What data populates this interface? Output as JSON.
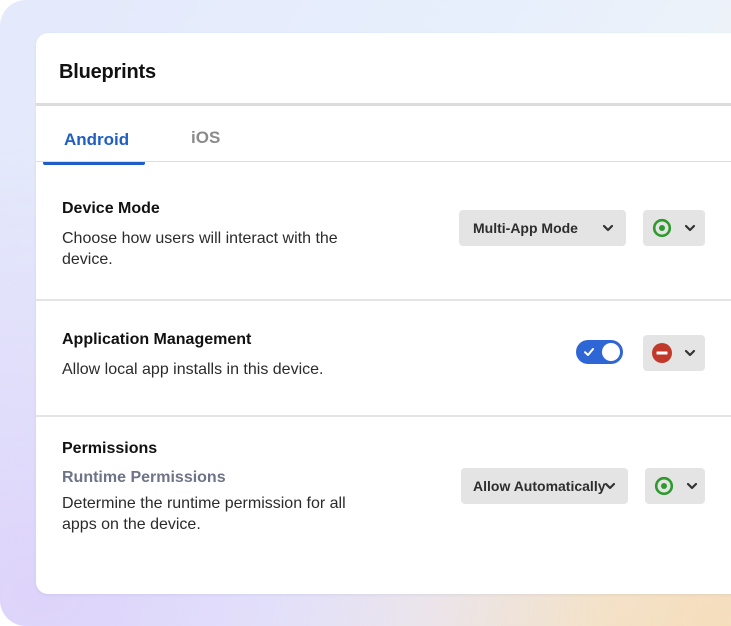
{
  "card": {
    "title": "Blueprints"
  },
  "tabs": [
    {
      "label": "Android",
      "active": true
    },
    {
      "label": "iOS",
      "active": false
    }
  ],
  "sections": [
    {
      "title": "Device Mode",
      "description": "Choose how users will interact with the device.",
      "control": {
        "type": "select",
        "value": "Multi-App Mode"
      },
      "status": {
        "icon": "target-icon",
        "color": "#2e9a2e"
      }
    },
    {
      "title": "Application Management",
      "description": "Allow local app installs in this device.",
      "control": {
        "type": "toggle",
        "on": true,
        "color": "#2f66d6"
      },
      "status": {
        "icon": "minus-circle-icon",
        "color": "#c0392b"
      }
    },
    {
      "title": "Permissions",
      "subtitle": "Runtime Permissions",
      "description": "Determine the runtime permission for all apps on the device.",
      "control": {
        "type": "select",
        "value": "Allow Automatically"
      },
      "status": {
        "icon": "target-icon",
        "color": "#2e9a2e"
      }
    }
  ],
  "colors": {
    "accent": "#1f5fc5",
    "inactive_tab": "#8b8b8b",
    "control_bg": "#e4e4e4"
  }
}
